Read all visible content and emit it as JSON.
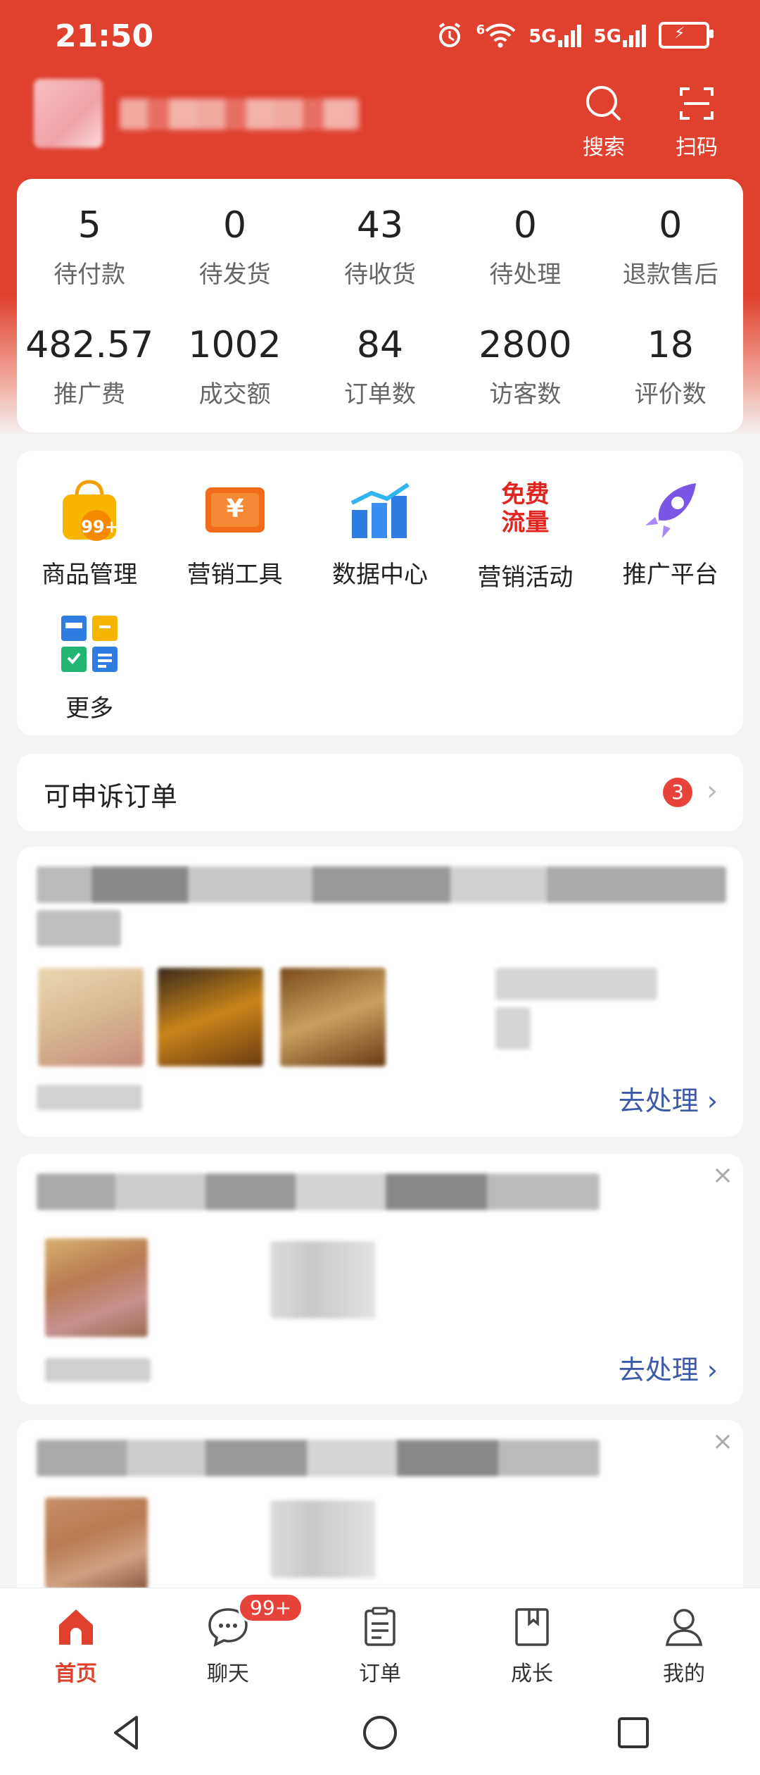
{
  "status_bar": {
    "time": "21:50",
    "net1": "5G",
    "net2": "5G",
    "wifi_tag": "6"
  },
  "header": {
    "search_label": "搜索",
    "scan_label": "扫码"
  },
  "stats": {
    "row1": [
      {
        "value": "5",
        "label": "待付款"
      },
      {
        "value": "0",
        "label": "待发货"
      },
      {
        "value": "43",
        "label": "待收货"
      },
      {
        "value": "0",
        "label": "待处理"
      },
      {
        "value": "0",
        "label": "退款售后"
      }
    ],
    "row2": [
      {
        "value": "482.57",
        "label": "推广费"
      },
      {
        "value": "1002",
        "label": "成交额"
      },
      {
        "value": "84",
        "label": "订单数"
      },
      {
        "value": "2800",
        "label": "访客数"
      },
      {
        "value": "18",
        "label": "评价数"
      }
    ]
  },
  "tools": [
    {
      "label": "商品管理",
      "icon": "shopping-bag-icon",
      "badge": "99+"
    },
    {
      "label": "营销工具",
      "icon": "coupon-icon",
      "glyph": "¥"
    },
    {
      "label": "数据中心",
      "icon": "bar-chart-icon"
    },
    {
      "label": "营销活动",
      "icon": "free-traffic-icon",
      "text1": "免费",
      "text2": "流量"
    },
    {
      "label": "推广平台",
      "icon": "rocket-icon"
    },
    {
      "label": "更多",
      "icon": "more-grid-icon"
    }
  ],
  "appeal": {
    "title": "可申诉订单",
    "count": "3"
  },
  "order_cards": [
    {
      "action": "去处理"
    },
    {
      "action": "去处理"
    }
  ],
  "tabbar": [
    {
      "label": "首页",
      "icon": "home-icon"
    },
    {
      "label": "聊天",
      "icon": "chat-icon",
      "badge": "99+"
    },
    {
      "label": "订单",
      "icon": "order-icon"
    },
    {
      "label": "成长",
      "icon": "book-icon"
    },
    {
      "label": "我的",
      "icon": "profile-icon"
    }
  ],
  "colors": {
    "brand": "#e0412f",
    "link": "#3c5aa8",
    "badge": "#e8433a"
  }
}
